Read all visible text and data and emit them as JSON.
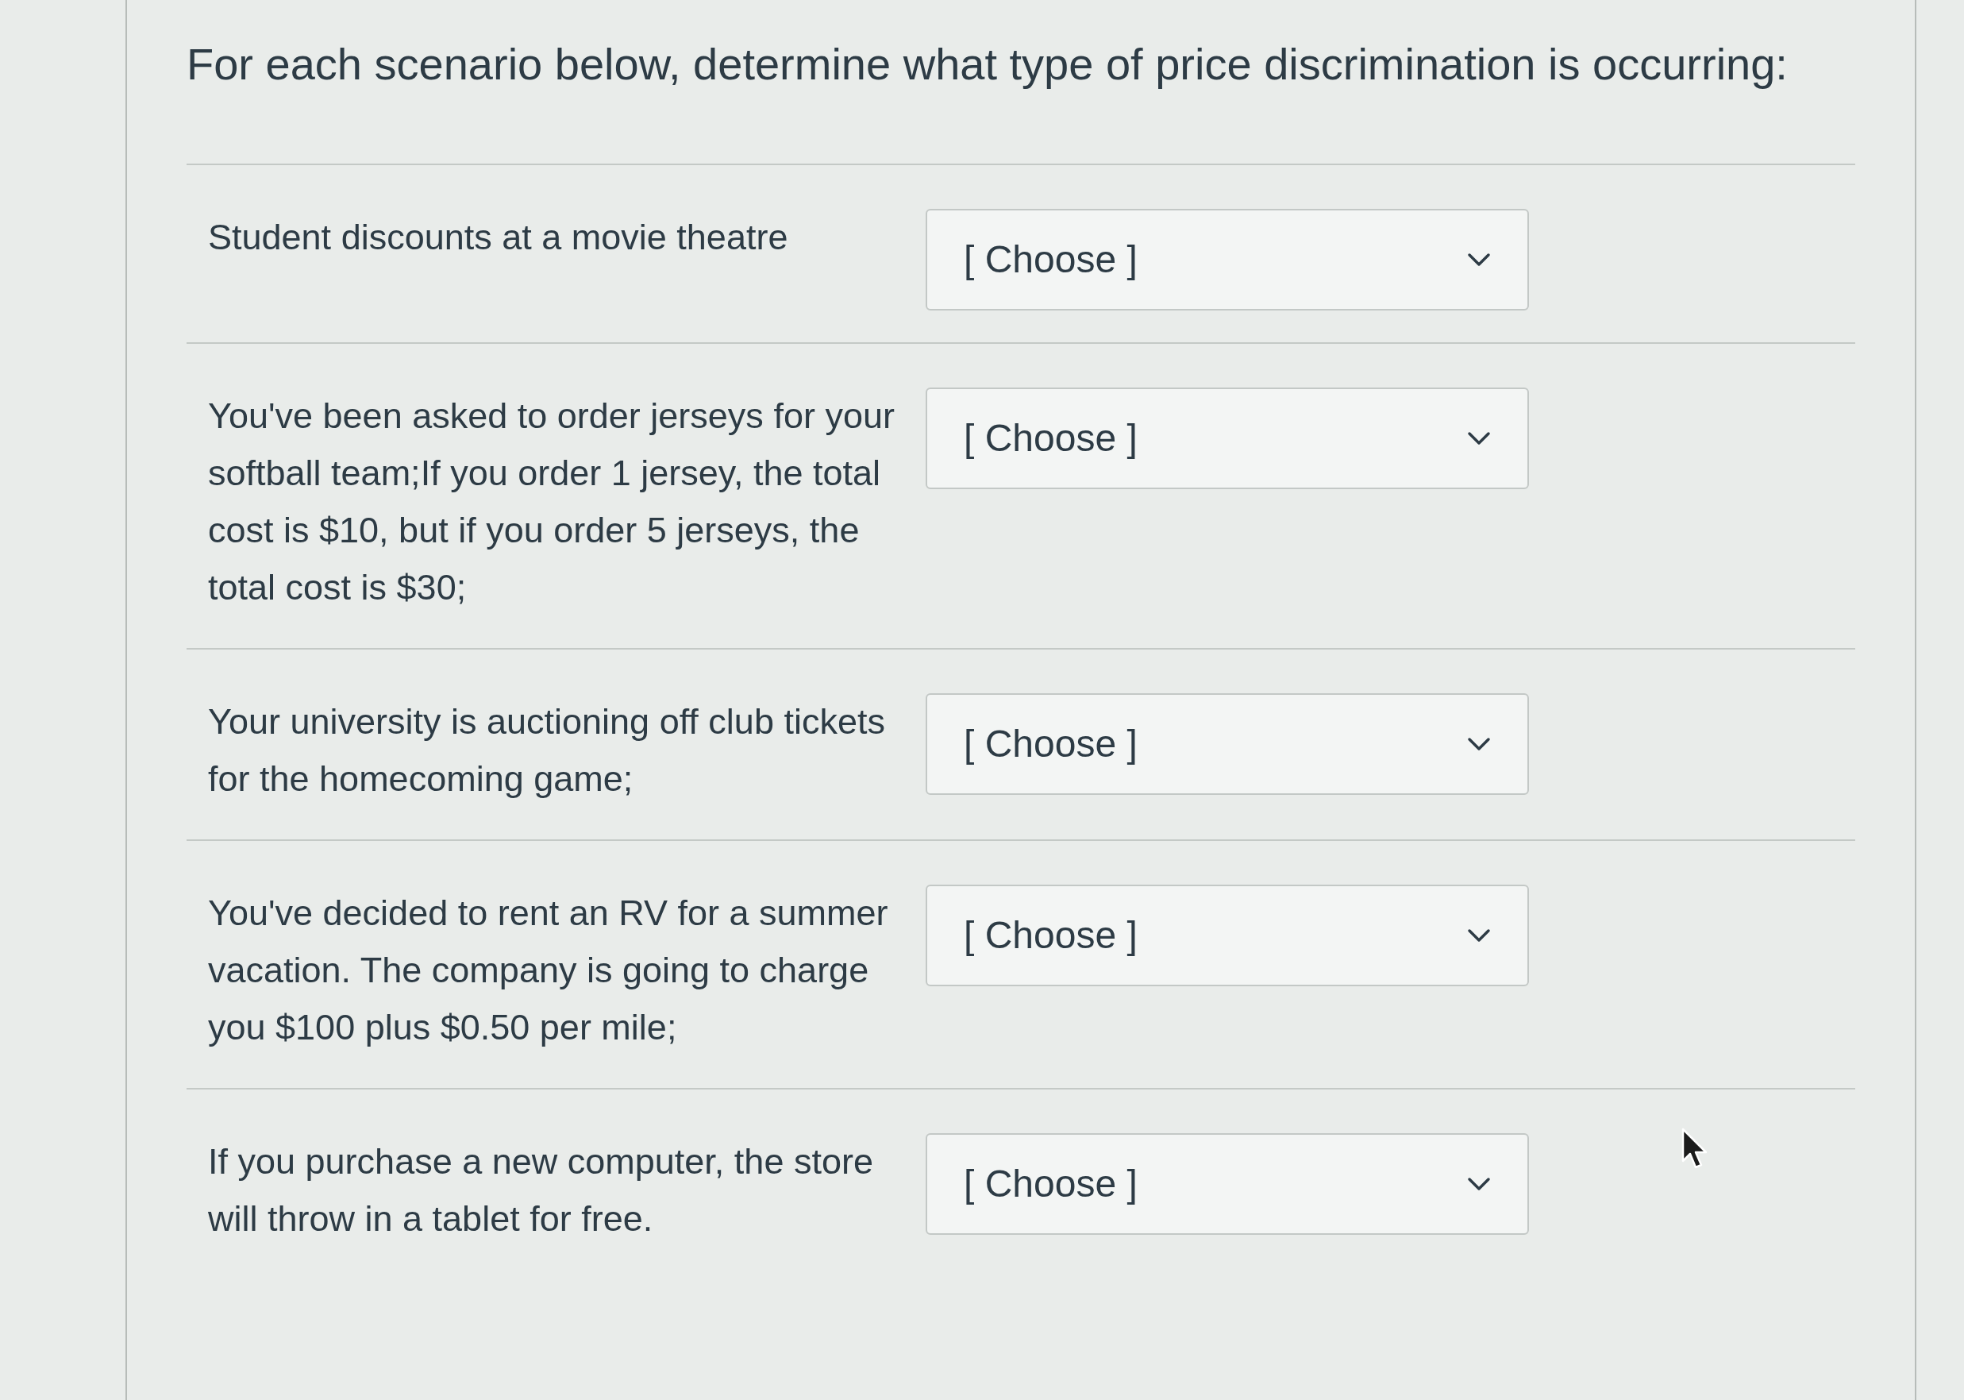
{
  "instruction": "For each scenario below, determine what type of price discrimination is occurring:",
  "questions": [
    {
      "scenario": "Student discounts at a movie theatre",
      "dropdown": {
        "value": "[ Choose ]"
      }
    },
    {
      "scenario": "You've been asked to order jerseys for your softball team;If you order 1 jersey, the total cost is $10, but if you order 5 jerseys, the total cost is $30;",
      "dropdown": {
        "value": "[ Choose ]"
      }
    },
    {
      "scenario": "Your university is auctioning off club tickets for the homecoming game;",
      "dropdown": {
        "value": "[ Choose ]"
      }
    },
    {
      "scenario": "You've decided to rent an RV for a summer vacation. The company is going to charge you $100 plus $0.50 per mile;",
      "dropdown": {
        "value": "[ Choose ]"
      }
    },
    {
      "scenario": "If you purchase a new computer, the store will throw in a tablet for free.",
      "dropdown": {
        "value": "[ Choose ]"
      }
    }
  ]
}
